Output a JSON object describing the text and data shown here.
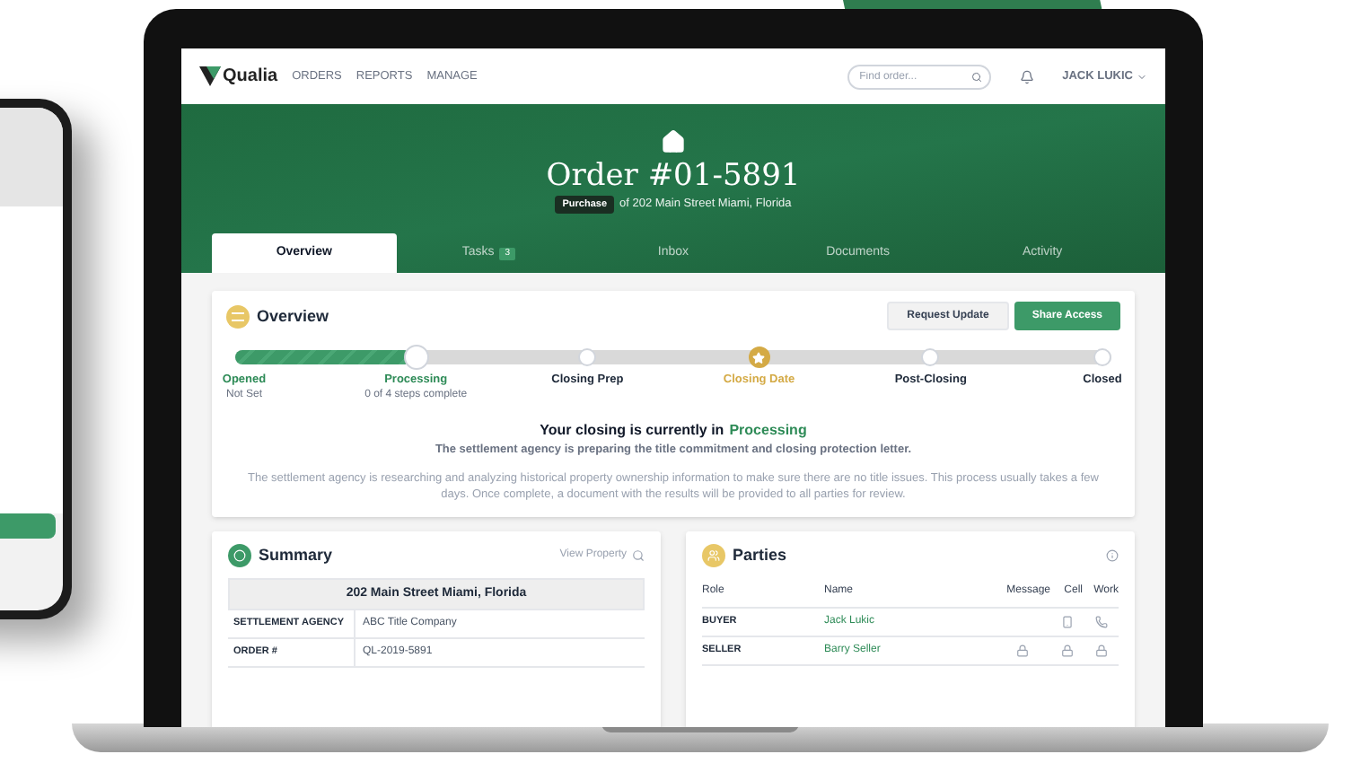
{
  "nav": {
    "logo": "Qualia",
    "links": [
      "ORDERS",
      "REPORTS",
      "MANAGE"
    ],
    "search": {
      "placeholder": "Find order..."
    },
    "user": "JACK LUKIC"
  },
  "header": {
    "title": "Order #01-5891",
    "badge": "Purchase",
    "subtitle": "of 202 Main Street Miami, Florida"
  },
  "tabs": [
    {
      "label": "Overview",
      "selected": true
    },
    {
      "label": "Tasks",
      "badge": "3",
      "selected": false
    },
    {
      "label": "Inbox",
      "selected": false
    },
    {
      "label": "Documents",
      "selected": false
    },
    {
      "label": "Activity",
      "selected": false
    }
  ],
  "overview": {
    "title": "Overview",
    "buttons": [
      {
        "label": "Request Update",
        "kind": "secondary"
      },
      {
        "label": "Share Access",
        "kind": "primary"
      }
    ],
    "progress": {
      "level": 0.2
    },
    "steps": [
      {
        "kind": "done",
        "label": "Opened",
        "note": "Not Set"
      },
      {
        "kind": "current",
        "label": "Processing",
        "note": "0 of 4 steps complete"
      },
      {
        "kind": "upcoming",
        "label": "Closing Prep"
      },
      {
        "kind": "milestone",
        "label": "Closing Date"
      },
      {
        "kind": "upcoming",
        "label": "Post-Closing"
      },
      {
        "kind": "upcoming",
        "label": "Closed"
      }
    ],
    "status_prefix": "Your closing is currently in",
    "status_stage": "Processing",
    "status_note": "The settlement agency is preparing the title commitment and closing protection letter.",
    "details": "The settlement agency is researching and analyzing historical property ownership information to make sure there are no title issues. This process usually takes a few days. Once complete, a document with the results will be provided to all parties for review."
  },
  "summary": {
    "title": "Summary",
    "link": "View Property",
    "address": "202 Main Street Miami, Florida",
    "rows": [
      {
        "label": "SETTLEMENT AGENCY",
        "value": "ABC Title Company"
      },
      {
        "label": "ORDER #",
        "value": "QL-2019-5891"
      }
    ]
  },
  "parties": {
    "title": "Parties",
    "columns": [
      "Role",
      "Name",
      "Message",
      "Cell",
      "Work"
    ],
    "rows": [
      {
        "role": "BUYER",
        "name": "Jack Lukic",
        "contacts": [
          {
            "kind": "none"
          },
          {
            "kind": "mobile"
          },
          {
            "kind": "phone"
          }
        ]
      },
      {
        "role": "SELLER",
        "name": "Barry Seller",
        "contacts": [
          {
            "kind": "lock"
          },
          {
            "kind": "lock"
          },
          {
            "kind": "lock"
          }
        ]
      }
    ]
  }
}
